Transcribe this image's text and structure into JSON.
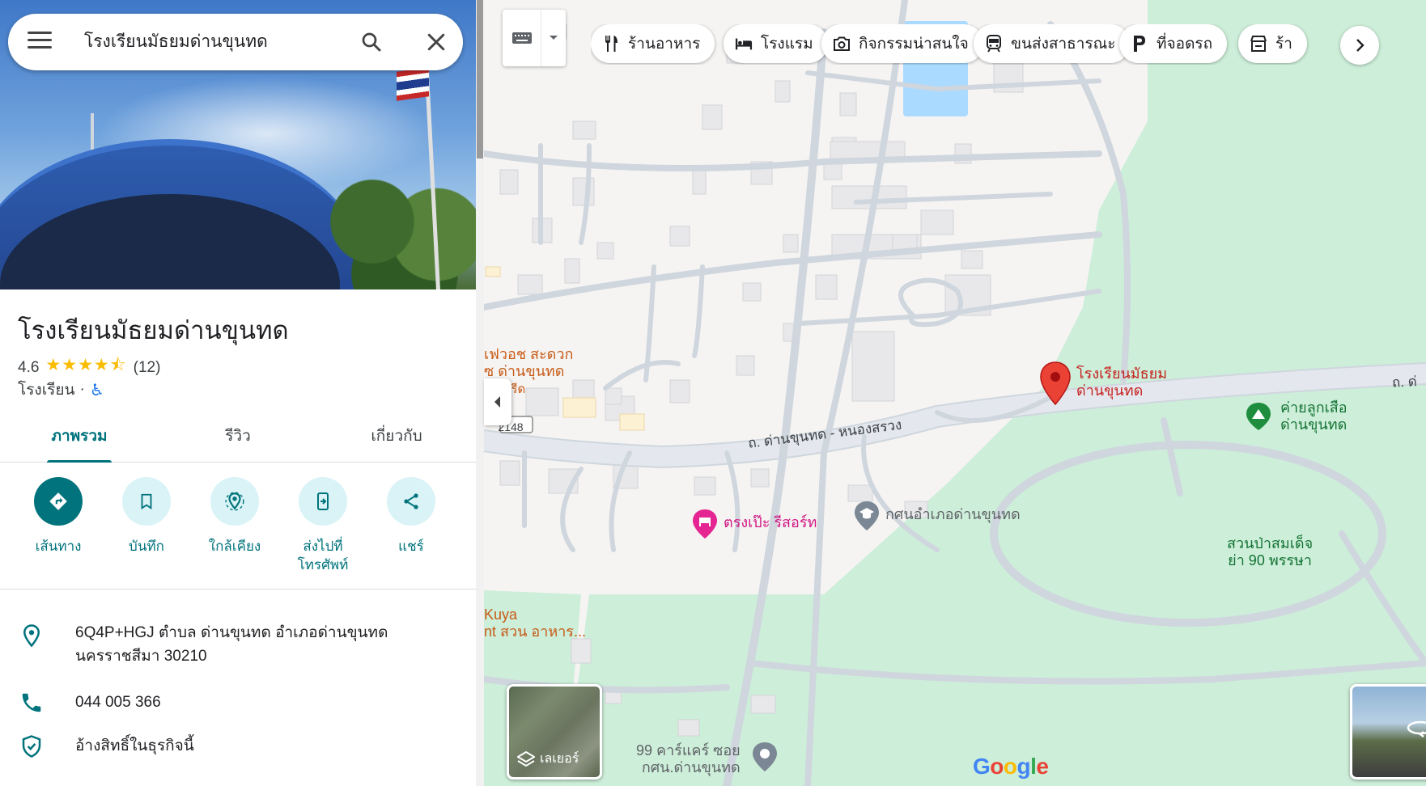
{
  "search": {
    "query": "โรงเรียนมัธยมด่านขุนทด"
  },
  "place": {
    "title": "โรงเรียนมัธยมด่านขุนทด",
    "rating": "4.6",
    "stars": "★★★★⯪",
    "review_count": "(12)",
    "category": "โรงเรียน",
    "separator": "·"
  },
  "tabs": [
    {
      "label": "ภาพรวม"
    },
    {
      "label": "รีวิว"
    },
    {
      "label": "เกี่ยวกับ"
    }
  ],
  "actions": {
    "directions": "เส้นทาง",
    "save": "บันทึก",
    "nearby": "ใกล้เคียง",
    "send_line1": "ส่งไปที่",
    "send_line2": "โทรศัพท์",
    "share": "แชร์"
  },
  "info": {
    "address_line1": "6Q4P+HGJ ตำบล ด่านขุนทด อำเภอด่านขุนทด",
    "address_line2": "นครราชสีมา 30210",
    "phone": "044 005 366",
    "claim": "อ้างสิทธิ์ในธุรกิจนี้"
  },
  "chips": [
    {
      "label": "ร้านอาหาร",
      "icon": "restaurant-icon"
    },
    {
      "label": "โรงแรม",
      "icon": "hotel-icon"
    },
    {
      "label": "กิจกรรมน่าสนใจ",
      "icon": "camera-icon"
    },
    {
      "label": "ขนส่งสาธารณะ",
      "icon": "transit-icon"
    },
    {
      "label": "ที่จอดรถ",
      "icon": "parking-icon"
    },
    {
      "label": "ร้า",
      "icon": "store-icon"
    }
  ],
  "map_labels": {
    "school_line1": "โรงเรียนมัธยม",
    "school_line2": "ด่านขุนทด",
    "camp_line1": "ค่ายลูกเสือ",
    "camp_line2": "ด่านขุนทด",
    "park_line1": "สวนป่าสมเด็จ",
    "park_line2": "ย่า 90 พรรษา",
    "resort": "ตรงเป๊ะ รีสอร์ท",
    "kshn": "กศนอำเภอด่านขุนทด",
    "road_main": "ถ. ด่านขุนทด - หนองสรวง",
    "road_right": "ถ. ด่",
    "shop_line1": "เฟวอช สะดวก",
    "shop_line2": "ซ ด่านขุนทด",
    "shop_line3": "เก่อนรีด",
    "route": "2148",
    "kuya_line1": "Kuya",
    "kuya_line2": "nt สวน อาหาร...",
    "carcare_line1": "99 คาร์แคร์ ซอย",
    "carcare_line2": "กศน.ด่านขุนทด"
  },
  "layers": {
    "label": "เลเยอร์"
  },
  "logo": "Google",
  "colors": {
    "accent": "#00737c",
    "pin": "#ea4335",
    "park": "#cdeed9",
    "road": "#cfd6de"
  }
}
